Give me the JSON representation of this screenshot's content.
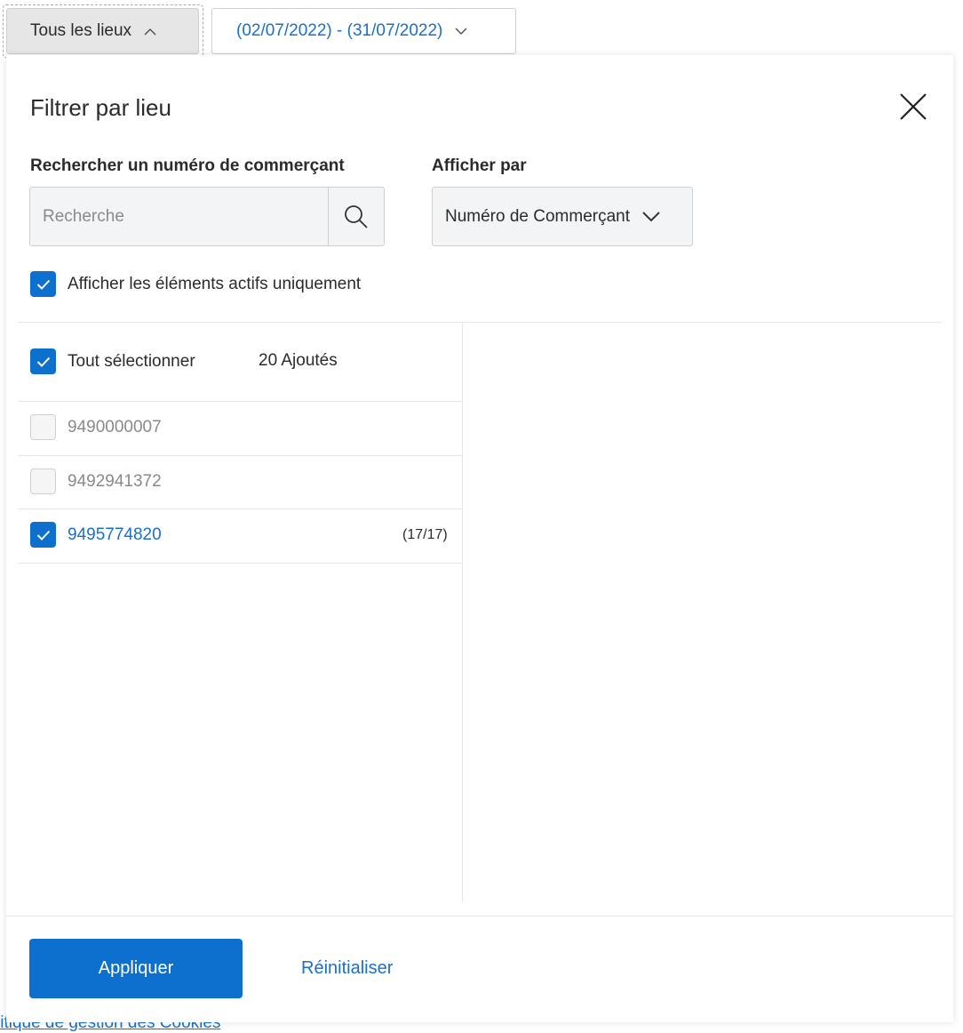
{
  "toolbar": {
    "location_button": "Tous les lieux",
    "date_range": "(02/07/2022) - (31/07/2022)"
  },
  "background": {
    "cookies_link": "litique de gestion des Cookies"
  },
  "panel": {
    "title": "Filtrer par lieu",
    "search_label": "Rechercher un numéro de commerçant",
    "search_placeholder": "Recherche",
    "search_value": "",
    "display_by_label": "Afficher par",
    "display_by_value": "Numéro de Commerçant",
    "active_only": {
      "label": "Afficher les éléments actifs uniquement",
      "checked": true
    },
    "select_all": {
      "label": "Tout sélectionner",
      "checked": true,
      "count": "20 Ajoutés"
    },
    "merchants": [
      {
        "id": "9490000007",
        "checked": false,
        "count": ""
      },
      {
        "id": "9492941372",
        "checked": false,
        "count": ""
      },
      {
        "id": "9495774820",
        "checked": true,
        "count": "(17/17)"
      }
    ],
    "apply_label": "Appliquer",
    "reset_label": "Réinitialiser"
  },
  "colors": {
    "accent": "#0d6fce",
    "link": "#1a6fc9"
  }
}
